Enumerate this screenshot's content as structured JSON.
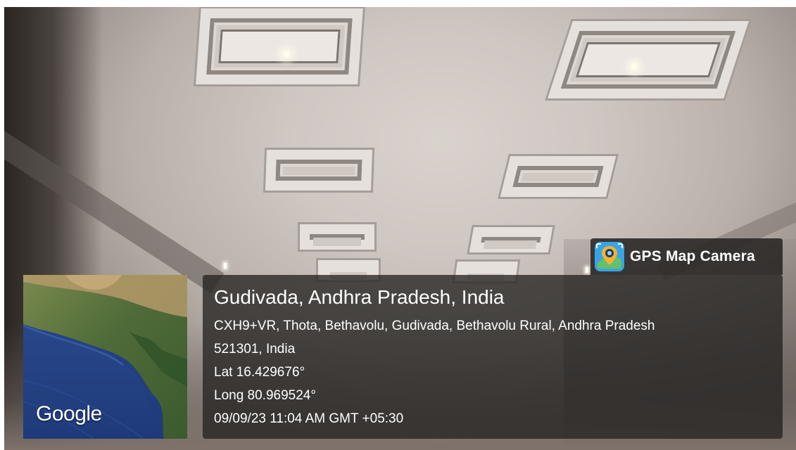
{
  "watermark": {
    "app_name": "GPS Map Camera",
    "app_icon": "gps-map-camera-icon"
  },
  "map": {
    "logo_text": "Google"
  },
  "location": {
    "title": "Gudivada, Andhra Pradesh, India",
    "address_line1": "CXH9+VR, Thota, Bethavolu, Gudivada, Bethavolu Rural, Andhra Pradesh",
    "address_line2": "521301, India",
    "latitude": "Lat 16.429676°",
    "longitude": "Long 80.969524°",
    "timestamp": "09/09/23 11:04 AM GMT +05:30"
  }
}
